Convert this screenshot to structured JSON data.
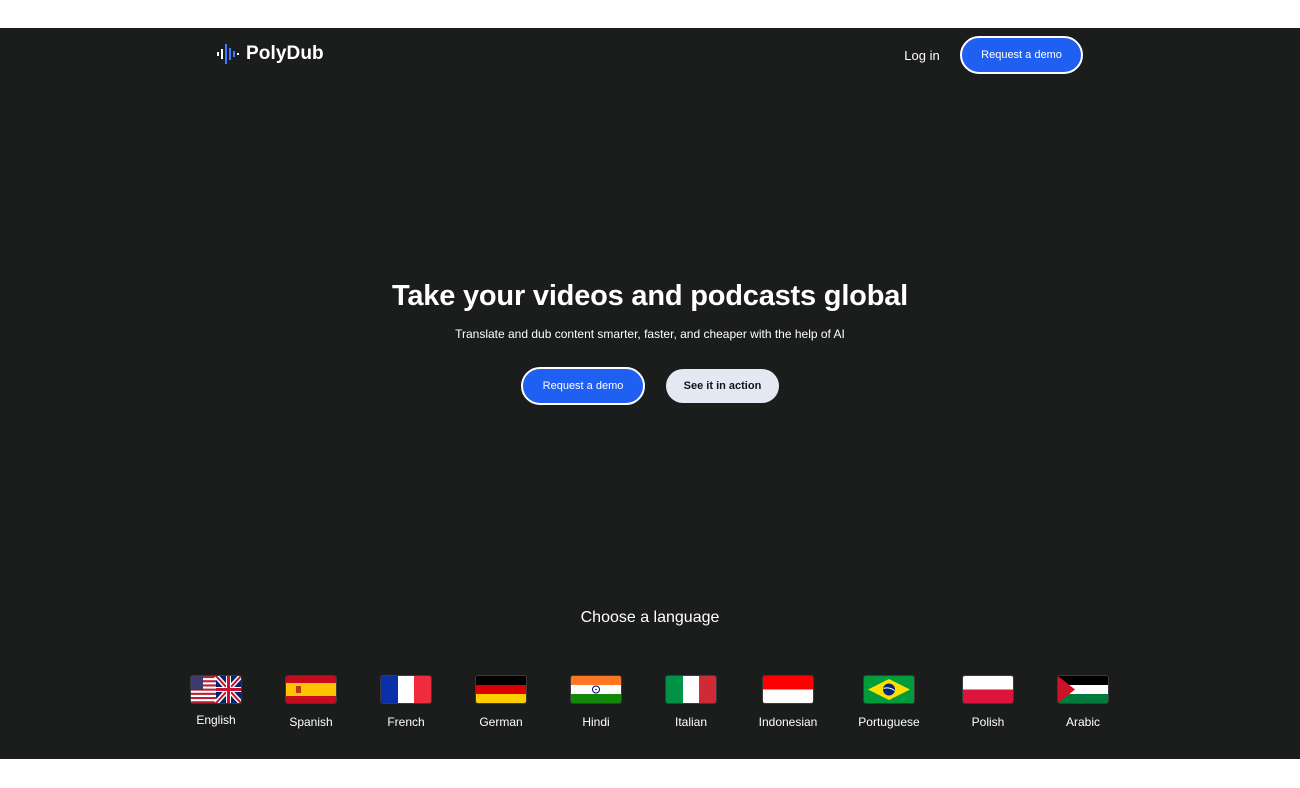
{
  "header": {
    "brand": "PolyDub",
    "login_label": "Log in",
    "demo_label": "Request a demo"
  },
  "hero": {
    "title": "Take your videos and podcasts global",
    "subtitle": "Translate and dub content smarter, faster, and cheaper with the help of AI",
    "primary_cta": "Request a demo",
    "secondary_cta": "See it in action"
  },
  "languages": {
    "heading": "Choose a language",
    "items": [
      {
        "label": "English",
        "flag": "flag-us-uk-icon"
      },
      {
        "label": "Spanish",
        "flag": "flag-spain-icon"
      },
      {
        "label": "French",
        "flag": "flag-france-icon"
      },
      {
        "label": "German",
        "flag": "flag-germany-icon"
      },
      {
        "label": "Hindi",
        "flag": "flag-india-icon"
      },
      {
        "label": "Italian",
        "flag": "flag-italy-icon"
      },
      {
        "label": "Indonesian",
        "flag": "flag-indonesia-icon"
      },
      {
        "label": "Portuguese",
        "flag": "flag-brazil-icon"
      },
      {
        "label": "Polish",
        "flag": "flag-poland-icon"
      },
      {
        "label": "Arabic",
        "flag": "flag-palestine-icon"
      }
    ]
  },
  "colors": {
    "background": "#1b1c1c",
    "accent": "#1f5ff2",
    "secondary_button": "#e4e8f2"
  }
}
